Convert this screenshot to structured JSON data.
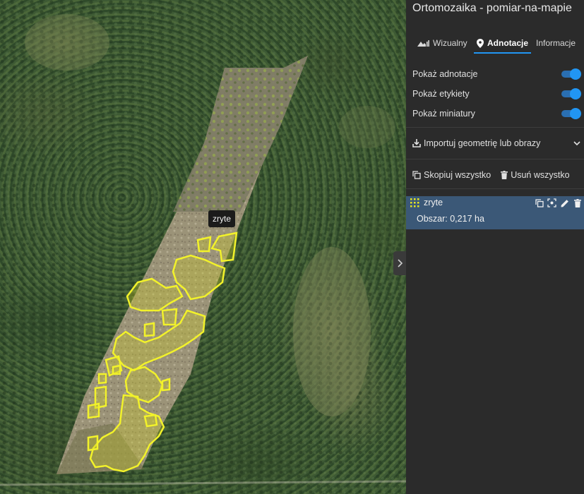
{
  "panel": {
    "title": "Ortomozaika - pomiar-na-mapie",
    "tabs": [
      {
        "label": "Wizualny",
        "icon": "terrain-icon"
      },
      {
        "label": "Adnotacje",
        "icon": "map-pin-icon",
        "active": true
      },
      {
        "label": "Informacje"
      }
    ],
    "toggles": [
      {
        "label": "Pokaż adnotacje",
        "on": true
      },
      {
        "label": "Pokaż etykiety",
        "on": true
      },
      {
        "label": "Pokaż miniatury",
        "on": true
      }
    ],
    "import_label": "Importuj geometrię lub obrazy",
    "copy_all_label": "Skopiuj wszystko",
    "delete_all_label": "Usuń wszystko",
    "annotation": {
      "name": "zryte",
      "area": "Obszar: 0,217 ha",
      "color": "#e8e820"
    },
    "accent_color": "#2196f3"
  },
  "map": {
    "tooltip": "zryte"
  }
}
